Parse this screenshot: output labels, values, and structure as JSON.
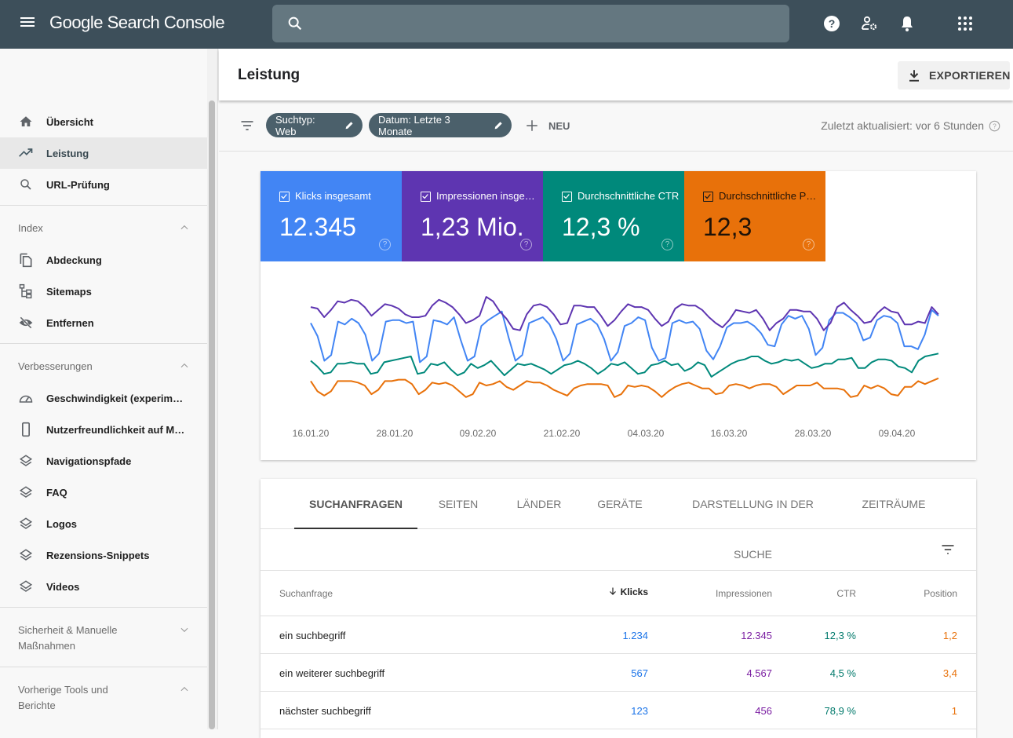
{
  "header": {
    "app_title_google": "Google",
    "app_title_rest": "Search Console",
    "search_placeholder": ""
  },
  "sidebar": {
    "top_items": [
      {
        "label": "Übersicht",
        "icon": "home-icon"
      },
      {
        "label": "Leistung",
        "icon": "trending-up-icon",
        "active": true
      },
      {
        "label": "URL-Prüfung",
        "icon": "search-icon"
      }
    ],
    "sections": [
      {
        "title": "Index",
        "expanded": true,
        "items": [
          {
            "label": "Abdeckung",
            "icon": "copy-icon"
          },
          {
            "label": "Sitemaps",
            "icon": "sitemap-icon"
          },
          {
            "label": "Entfernen",
            "icon": "visibility-off-icon"
          }
        ]
      },
      {
        "title": "Verbesserungen",
        "expanded": true,
        "items": [
          {
            "label": "Geschwindigkeit (experimentell)",
            "icon": "speed-icon"
          },
          {
            "label": "Nutzerfreundlichkeit auf Mobilgeräten",
            "icon": "smartphone-icon"
          },
          {
            "label": "Navigationspfade",
            "icon": "layers-icon"
          },
          {
            "label": "FAQ",
            "icon": "layers-icon"
          },
          {
            "label": "Logos",
            "icon": "layers-icon"
          },
          {
            "label": "Rezensions-Snippets",
            "icon": "layers-icon"
          },
          {
            "label": "Videos",
            "icon": "layers-icon"
          }
        ]
      },
      {
        "title_line1": "Sicherheit & Manuelle",
        "title_line2": "Maßnahmen",
        "expanded": false
      },
      {
        "title_line1": "Vorherige Tools und",
        "title_line2": "Berichte",
        "expanded": true
      }
    ]
  },
  "page": {
    "title": "Leistung",
    "export_label": "EXPORTIEREN"
  },
  "filters": {
    "chips": [
      {
        "label": "Suchtyp: Web"
      },
      {
        "label": "Datum: Letzte 3 Monate"
      }
    ],
    "new_label": "NEU",
    "updated_text": "Zuletzt aktualisiert: vor 6 Stunden"
  },
  "metrics": [
    {
      "label": "Klicks insgesamt",
      "value": "12.345",
      "color": "#4285f4",
      "checked": true
    },
    {
      "label": "Impressionen insgesamt",
      "value": "1,23 Mio.",
      "color": "#5e35b1",
      "checked": true
    },
    {
      "label": "Durchschnittliche CTR",
      "value": "12,3 %",
      "color": "#00897b",
      "checked": true
    },
    {
      "label": "Durchschnittliche Position",
      "value": "12,3",
      "color": "#e8710a",
      "checked": true
    }
  ],
  "chart_data": {
    "type": "line",
    "title": "",
    "xlabel": "",
    "ylabel": "",
    "x_ticks": [
      "16.01.20",
      "28.01.20",
      "09.02.20",
      "21.02.20",
      "04.03.20",
      "16.03.20",
      "28.03.20",
      "09.04.20"
    ],
    "x_range": [
      "16.01.20",
      "15.04.20"
    ],
    "y_note": "relative normalized scale 0-100, axes hidden",
    "ylim": [
      0,
      100
    ],
    "grid": false,
    "series": [
      {
        "name": "Impressionen",
        "color": "#5e35b1",
        "values": [
          74,
          73,
          67,
          72,
          78,
          77,
          79,
          78,
          74,
          68,
          72,
          76,
          75,
          73,
          69,
          67,
          67,
          68,
          75,
          79,
          77,
          74,
          69,
          63,
          65,
          68,
          81,
          78,
          71,
          66,
          59,
          58,
          69,
          75,
          76,
          74,
          69,
          62,
          63,
          75,
          75,
          74,
          74,
          68,
          61,
          65,
          71,
          76,
          74,
          74,
          72,
          66,
          61,
          64,
          73,
          76,
          75,
          75,
          72,
          67,
          63,
          60,
          65,
          72,
          71,
          70,
          72,
          66,
          58,
          63,
          66,
          72,
          72,
          71,
          71,
          66,
          58,
          63,
          74,
          77,
          72,
          68,
          63,
          64,
          70,
          74,
          71,
          70,
          62,
          62,
          64,
          63,
          74,
          69
        ]
      },
      {
        "name": "Klicks",
        "color": "#4285f4",
        "values": [
          63,
          54,
          37,
          41,
          64,
          62,
          66,
          63,
          55,
          37,
          42,
          64,
          65,
          65,
          63,
          64,
          36,
          40,
          65,
          64,
          62,
          67,
          51,
          37,
          40,
          61,
          65,
          68,
          71,
          53,
          37,
          41,
          63,
          65,
          67,
          62,
          52,
          37,
          42,
          62,
          64,
          66,
          62,
          52,
          37,
          43,
          61,
          63,
          67,
          65,
          46,
          37,
          39,
          63,
          65,
          63,
          64,
          59,
          44,
          38,
          47,
          60,
          63,
          63,
          64,
          61,
          56,
          48,
          47,
          62,
          68,
          66,
          68,
          59,
          41,
          46,
          65,
          70,
          70,
          67,
          63,
          51,
          53,
          65,
          68,
          67,
          63,
          47,
          47,
          45,
          55,
          72,
          68
        ]
      },
      {
        "name": "CTR",
        "color": "#00897b",
        "values": [
          37,
          33,
          28,
          29,
          35,
          35,
          36,
          35,
          35,
          28,
          29,
          36,
          37,
          38,
          39,
          40,
          28,
          29,
          35,
          34,
          36,
          31,
          27,
          29,
          35,
          32,
          34,
          37,
          32,
          27,
          31,
          35,
          34,
          35,
          33,
          31,
          28,
          31,
          34,
          35,
          37,
          35,
          32,
          28,
          31,
          35,
          34,
          36,
          32,
          28,
          29,
          34,
          35,
          37,
          34,
          35,
          30,
          32,
          36,
          34,
          26,
          29,
          32,
          35,
          37,
          38,
          40,
          40,
          37,
          35,
          36,
          38,
          37,
          38,
          35,
          32,
          33,
          35,
          35,
          38,
          38,
          39,
          32,
          32,
          36,
          38,
          38,
          37,
          33,
          32,
          29,
          37,
          40,
          41,
          42
        ]
      },
      {
        "name": "Position",
        "color": "#e8710a",
        "values": [
          23,
          16,
          13,
          16,
          23,
          23,
          23,
          22,
          20,
          14,
          17,
          23,
          23,
          24,
          24,
          21,
          14,
          17,
          22,
          21,
          22,
          20,
          16,
          12,
          14,
          22,
          20,
          21,
          23,
          19,
          17,
          20,
          23,
          22,
          22,
          20,
          17,
          15,
          13,
          18,
          20,
          21,
          21,
          21,
          20,
          12,
          14,
          20,
          19,
          20,
          19,
          16,
          12,
          16,
          19,
          21,
          22,
          20,
          18,
          18,
          14,
          15,
          20,
          21,
          20,
          18,
          20,
          21,
          21,
          19,
          14,
          17,
          20,
          20,
          20,
          22,
          18,
          18,
          18,
          17,
          12,
          13,
          20,
          18,
          20,
          18,
          14,
          13,
          19,
          19,
          23,
          21,
          23,
          25
        ]
      }
    ]
  },
  "table": {
    "tabs": [
      "SUCHANFRAGEN",
      "SEITEN",
      "LÄNDER",
      "GERÄTE",
      "DARSTELLUNG IN DER SUCHE",
      "ZEITRÄUME"
    ],
    "active_tab": 0,
    "columns": [
      "Suchanfrage",
      "Klicks",
      "Impressionen",
      "CTR",
      "Position"
    ],
    "sort_column": "Klicks",
    "rows": [
      {
        "query": "ein suchbegriff",
        "clicks": "1.234",
        "impressions": "12.345",
        "ctr": "12,3 %",
        "position": "1,2"
      },
      {
        "query": "ein weiterer suchbegriff",
        "clicks": "567",
        "impressions": "4.567",
        "ctr": "4,5 %",
        "position": "3,4"
      },
      {
        "query": "nächster suchbegriff",
        "clicks": "123",
        "impressions": "456",
        "ctr": "78,9 %",
        "position": "1"
      }
    ],
    "colors": {
      "clicks": "#1a73e8",
      "impressions": "#7b1fa2",
      "ctr": "#00796b",
      "position": "#e8710a"
    }
  }
}
